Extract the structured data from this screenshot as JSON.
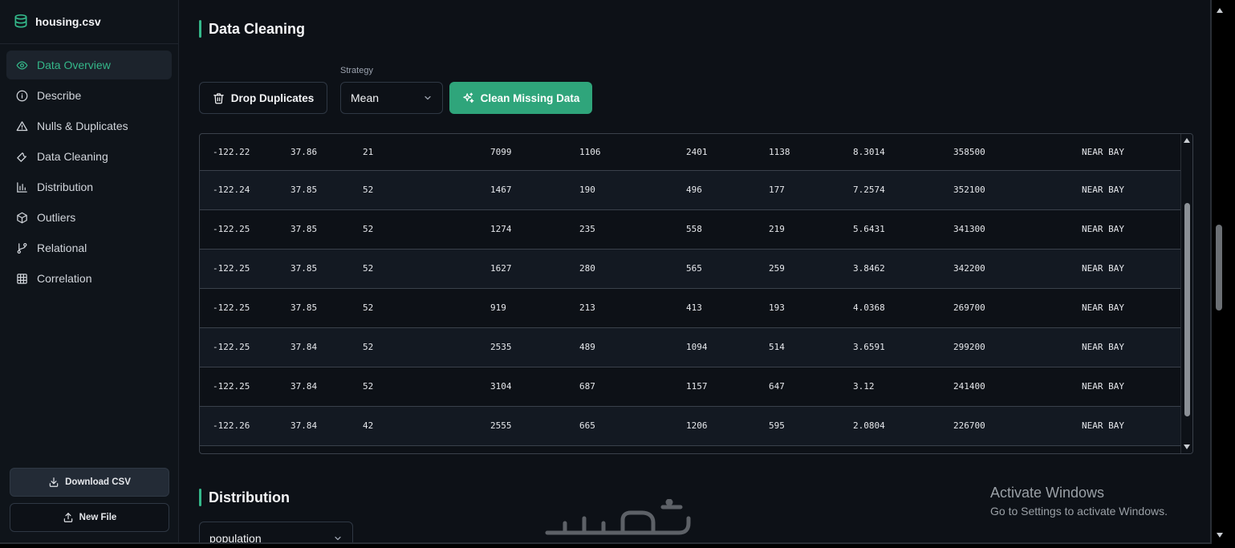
{
  "app": {
    "file_name": "housing.csv"
  },
  "sidebar": {
    "items": [
      {
        "label": "Data Overview",
        "icon": "eye-icon",
        "active": true
      },
      {
        "label": "Describe",
        "icon": "info-icon",
        "active": false
      },
      {
        "label": "Nulls & Duplicates",
        "icon": "warning-icon",
        "active": false
      },
      {
        "label": "Data Cleaning",
        "icon": "wrench-icon",
        "active": false
      },
      {
        "label": "Distribution",
        "icon": "bar-chart-icon",
        "active": false
      },
      {
        "label": "Outliers",
        "icon": "cube-icon",
        "active": false
      },
      {
        "label": "Relational",
        "icon": "git-branch-icon",
        "active": false
      },
      {
        "label": "Correlation",
        "icon": "grid-icon",
        "active": false
      }
    ],
    "download_label": "Download CSV",
    "new_file_label": "New File"
  },
  "cleaning": {
    "title": "Data Cleaning",
    "drop_label": "Drop Duplicates",
    "strategy_label": "Strategy",
    "strategy_value": "Mean",
    "clean_label": "Clean Missing Data"
  },
  "table": {
    "rows": [
      [
        "-122.22",
        "37.86",
        "21",
        "7099",
        "1106",
        "2401",
        "1138",
        "8.3014",
        "358500",
        "NEAR BAY"
      ],
      [
        "-122.24",
        "37.85",
        "52",
        "1467",
        "190",
        "496",
        "177",
        "7.2574",
        "352100",
        "NEAR BAY"
      ],
      [
        "-122.25",
        "37.85",
        "52",
        "1274",
        "235",
        "558",
        "219",
        "5.6431",
        "341300",
        "NEAR BAY"
      ],
      [
        "-122.25",
        "37.85",
        "52",
        "1627",
        "280",
        "565",
        "259",
        "3.8462",
        "342200",
        "NEAR BAY"
      ],
      [
        "-122.25",
        "37.85",
        "52",
        "919",
        "213",
        "413",
        "193",
        "4.0368",
        "269700",
        "NEAR BAY"
      ],
      [
        "-122.25",
        "37.84",
        "52",
        "2535",
        "489",
        "1094",
        "514",
        "3.6591",
        "299200",
        "NEAR BAY"
      ],
      [
        "-122.25",
        "37.84",
        "52",
        "3104",
        "687",
        "1157",
        "647",
        "3.12",
        "241400",
        "NEAR BAY"
      ],
      [
        "-122.26",
        "37.84",
        "42",
        "2555",
        "665",
        "1206",
        "595",
        "2.0804",
        "226700",
        "NEAR BAY"
      ],
      [
        "",
        "",
        "",
        "",
        "",
        "",
        "",
        "",
        "",
        ""
      ]
    ]
  },
  "distribution": {
    "title": "Distribution",
    "column_value": "population"
  },
  "overlay": {
    "activate_title": "Activate Windows",
    "activate_sub": "Go to Settings to activate Windows."
  },
  "colors": {
    "accent": "#34b88a",
    "button_green": "#2fa57b",
    "background": "#0d1117"
  }
}
